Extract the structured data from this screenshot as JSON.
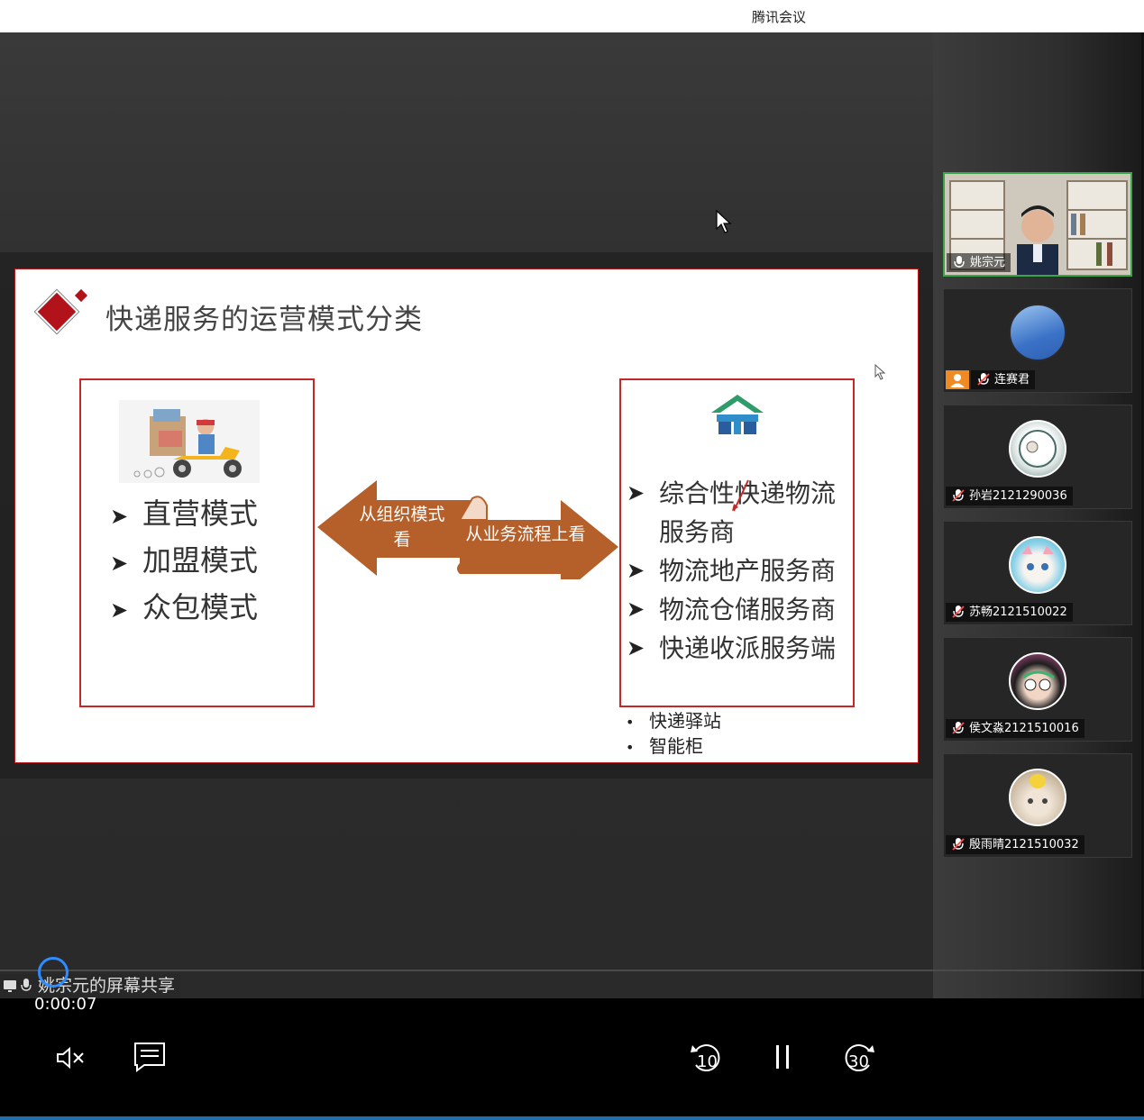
{
  "window": {
    "title": "腾讯会议"
  },
  "slide": {
    "title": "快递服务的运营模式分类",
    "left_list": [
      "直营模式",
      "加盟模式",
      "众包模式"
    ],
    "arrow_left_label": "从组织模式看",
    "arrow_right_label": "从业务流程上看",
    "right_list": [
      "综合性快递物流服务商",
      "物流地产服务商",
      "物流仓储服务商",
      "快递收派服务端"
    ],
    "bullets": [
      "快递驿站",
      "智能柜"
    ],
    "colors": {
      "frame": "#c62828",
      "arrow": "#b5602a",
      "diamond": "#b2131a"
    }
  },
  "participants": [
    {
      "name": "姚宗元",
      "state": "speaking",
      "video": true
    },
    {
      "name": "连赛君",
      "state": "muted",
      "video": false
    },
    {
      "name": "孙岩2121290036",
      "state": "muted",
      "video": false
    },
    {
      "name": "苏畅2121510022",
      "state": "muted",
      "video": false
    },
    {
      "name": "侯文淼2121510016",
      "state": "muted",
      "video": false
    },
    {
      "name": "殷雨晴2121510032",
      "state": "muted",
      "video": false
    }
  ],
  "share_label": "姚宗元的屏幕共享",
  "player": {
    "time": "0:00:07",
    "rewind_label": "10",
    "forward_label": "30",
    "icons": [
      "volume-mute-icon",
      "captions-icon",
      "rewind-10-icon",
      "pause-icon",
      "forward-30-icon"
    ]
  }
}
